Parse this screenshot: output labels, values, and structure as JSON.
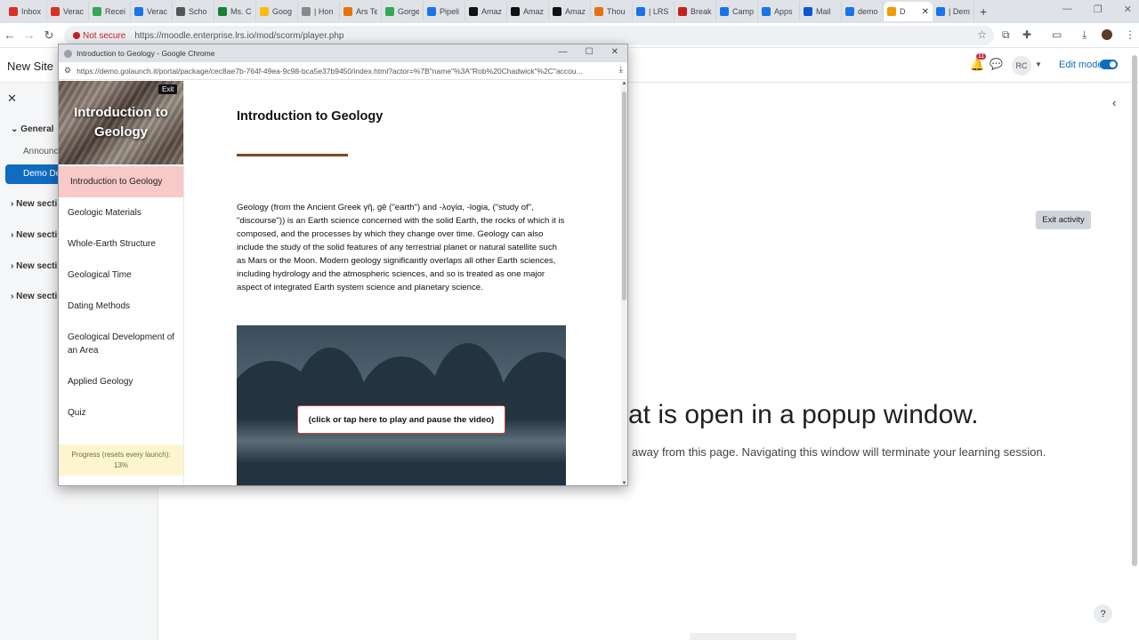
{
  "browser": {
    "tabs": [
      {
        "label": "Inbox",
        "color": "#d93025"
      },
      {
        "label": "Verac",
        "color": "#d93025"
      },
      {
        "label": "Recei",
        "color": "#34a853"
      },
      {
        "label": "Verac",
        "color": "#1a73e8"
      },
      {
        "label": "Scho",
        "color": "#555555"
      },
      {
        "label": "Ms. C",
        "color": "#188038"
      },
      {
        "label": "Goog",
        "color": "#fbbc04"
      },
      {
        "label": "| Hon",
        "color": "#888888"
      },
      {
        "label": "Ars Te",
        "color": "#e8710a"
      },
      {
        "label": "Gorge",
        "color": "#34a853"
      },
      {
        "label": "Pipeli",
        "color": "#1a73e8"
      },
      {
        "label": "Amaz",
        "color": "#111111"
      },
      {
        "label": "Amaz",
        "color": "#111111"
      },
      {
        "label": "Amaz",
        "color": "#111111"
      },
      {
        "label": "Thou",
        "color": "#e8710a"
      },
      {
        "label": "| LRS",
        "color": "#1a73e8"
      },
      {
        "label": "Break",
        "color": "#c5221f"
      },
      {
        "label": "Camp",
        "color": "#1a73e8"
      },
      {
        "label": "Apps",
        "color": "#1a73e8"
      },
      {
        "label": "Mail",
        "color": "#0b57d0"
      },
      {
        "label": "demo",
        "color": "#1a73e8"
      },
      {
        "label": "D",
        "color": "#f29900"
      },
      {
        "label": "| Dem",
        "color": "#1a73e8"
      }
    ],
    "active_tab_index": 21,
    "new_tab": "+",
    "not_secure": "Not secure",
    "url": "https://moodle.enterprise.lrs.io/mod/scorm/player.php"
  },
  "moodle": {
    "site_name": "New Site",
    "notification_count": "11",
    "avatar_initials": "RC",
    "edit_mode_label": "Edit mode",
    "drawer": {
      "general": "General",
      "announcements": "Announc",
      "demo_item": "Demo De",
      "sections": [
        "New secti",
        "New secti",
        "New secti",
        "New secti"
      ]
    },
    "exit_activity": "Exit activity",
    "popup_message": "at is open in a popup window.",
    "popup_submessage": "away from this page. Navigating this window will terminate your learning session.",
    "help": "?"
  },
  "popup": {
    "window_title": "Introduction to Geology - Google Chrome",
    "url": "https://demo.golaunch.it/portal/package/cec8ae7b-764f-49ea-9c98-bca5e37b9450/index.html?actor=%7B\"name\"%3A\"Rob%20Chadwick\"%2C\"accou..."
  },
  "course": {
    "hero_title": "Introduction to Geology",
    "exit_label": "Exit",
    "menu": [
      "Introduction to Geology",
      "Geologic Materials",
      "Whole-Earth Structure",
      "Geological Time",
      "Dating Methods",
      "Geological Development of an Area",
      "Applied Geology",
      "Quiz"
    ],
    "active_menu_index": 0,
    "progress_label": "Progress (resets every launch):",
    "progress_value": "13%",
    "progress_fraction": 0.13,
    "content_title": "Introduction to Geology",
    "content_body": "Geology (from the Ancient Greek γῆ, gê (\"earth\") and -λoγία, -logia, (\"study of\", \"discourse\")) is an Earth science concerned with the solid Earth, the rocks of which it is composed, and the processes by which they change over time. Geology can also include the study of the solid features of any terrestrial planet or natural satellite such as Mars or the Moon. Modern geology significantly overlaps all other Earth sciences, including hydrology and the atmospheric sciences, and so is treated as one major aspect of integrated Earth system science and planetary science.",
    "video_button": "(click or tap here to play and pause the video)"
  }
}
